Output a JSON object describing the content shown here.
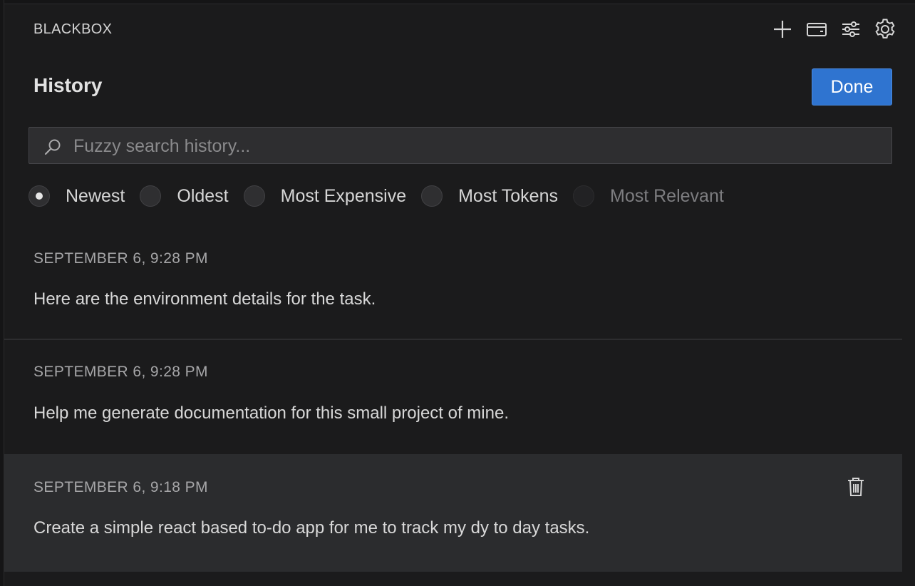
{
  "header": {
    "app_title": "BLACKBOX",
    "toolbar": [
      {
        "name": "plus-icon"
      },
      {
        "name": "wallet-icon"
      },
      {
        "name": "sliders-icon"
      },
      {
        "name": "gear-icon"
      }
    ]
  },
  "history": {
    "title": "History",
    "done_label": "Done",
    "search": {
      "placeholder": "Fuzzy search history...",
      "value": ""
    },
    "sort_options": [
      {
        "label": "Newest",
        "selected": true,
        "disabled": false
      },
      {
        "label": "Oldest",
        "selected": false,
        "disabled": false
      },
      {
        "label": "Most Expensive",
        "selected": false,
        "disabled": false
      },
      {
        "label": "Most Tokens",
        "selected": false,
        "disabled": false
      },
      {
        "label": "Most Relevant",
        "selected": false,
        "disabled": true
      }
    ],
    "items": [
      {
        "date": "SEPTEMBER 6, 9:28 PM",
        "text": "Here are the environment details for the task."
      },
      {
        "date": "SEPTEMBER 6, 9:28 PM",
        "text": "Help me generate documentation for this small project of mine."
      },
      {
        "date": "SEPTEMBER 6, 9:18 PM",
        "text": "Create a simple react based to-do app for me to track my dy to day tasks.",
        "hovered": true
      }
    ]
  },
  "colors": {
    "background": "#1b1b1c",
    "accent": "#2f74d0",
    "hover_row": "#2b2c2e"
  }
}
